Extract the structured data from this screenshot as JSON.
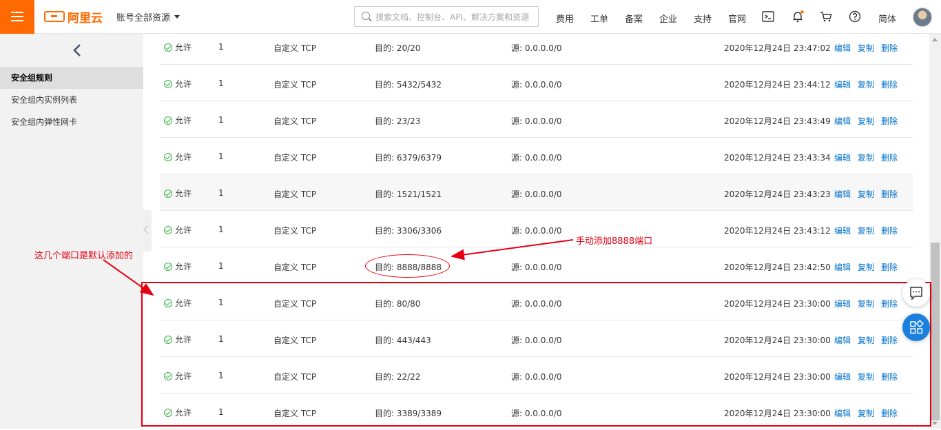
{
  "header": {
    "logo_text": "阿里云",
    "account_label": "账号全部资源",
    "search_placeholder": "搜索文档、控制台、API、解决方案和资源",
    "nav": [
      "费用",
      "工单",
      "备案",
      "企业",
      "支持",
      "官网"
    ],
    "language": "简体",
    "brand_color": "#ff6a00",
    "icons": [
      "terminal-icon",
      "bell-icon",
      "cart-icon",
      "help-icon"
    ]
  },
  "sidebar": {
    "items": [
      {
        "label": "安全组规则",
        "active": true
      },
      {
        "label": "安全组内实例列表",
        "active": false
      },
      {
        "label": "安全组内弹性网卡",
        "active": false
      }
    ]
  },
  "rules": [
    {
      "status": "允许",
      "priority": "1",
      "protocol": "自定义 TCP",
      "port": "目的: 20/20",
      "source": "源: 0.0.0.0/0",
      "time": "2020年12月24日 23:47:02"
    },
    {
      "status": "允许",
      "priority": "1",
      "protocol": "自定义 TCP",
      "port": "目的: 5432/5432",
      "source": "源: 0.0.0.0/0",
      "time": "2020年12月24日 23:44:12"
    },
    {
      "status": "允许",
      "priority": "1",
      "protocol": "自定义 TCP",
      "port": "目的: 23/23",
      "source": "源: 0.0.0.0/0",
      "time": "2020年12月24日 23:43:49"
    },
    {
      "status": "允许",
      "priority": "1",
      "protocol": "自定义 TCP",
      "port": "目的: 6379/6379",
      "source": "源: 0.0.0.0/0",
      "time": "2020年12月24日 23:43:34"
    },
    {
      "status": "允许",
      "priority": "1",
      "protocol": "自定义 TCP",
      "port": "目的: 1521/1521",
      "source": "源: 0.0.0.0/0",
      "time": "2020年12月24日 23:43:23"
    },
    {
      "status": "允许",
      "priority": "1",
      "protocol": "自定义 TCP",
      "port": "目的: 3306/3306",
      "source": "源: 0.0.0.0/0",
      "time": "2020年12月24日 23:43:12"
    },
    {
      "status": "允许",
      "priority": "1",
      "protocol": "自定义 TCP",
      "port": "目的: 8888/8888",
      "source": "源: 0.0.0.0/0",
      "time": "2020年12月24日 23:42:50"
    },
    {
      "status": "允许",
      "priority": "1",
      "protocol": "自定义 TCP",
      "port": "目的: 80/80",
      "source": "源: 0.0.0.0/0",
      "time": "2020年12月24日 23:30:00"
    },
    {
      "status": "允许",
      "priority": "1",
      "protocol": "自定义 TCP",
      "port": "目的: 443/443",
      "source": "源: 0.0.0.0/0",
      "time": "2020年12月24日 23:30:00"
    },
    {
      "status": "允许",
      "priority": "1",
      "protocol": "自定义 TCP",
      "port": "目的: 22/22",
      "source": "源: 0.0.0.0/0",
      "time": "2020年12月24日 23:30:00"
    },
    {
      "status": "允许",
      "priority": "1",
      "protocol": "自定义 TCP",
      "port": "目的: 3389/3389",
      "source": "源: 0.0.0.0/0",
      "time": "2020年12月24日 23:30:00"
    }
  ],
  "row_actions": {
    "edit": "编辑",
    "copy": "复制",
    "delete": "删除"
  },
  "annotations": {
    "default_ports": "这几个端口是默认添加的",
    "manual_port": "手动添加8888端口",
    "color": "#e60012"
  }
}
